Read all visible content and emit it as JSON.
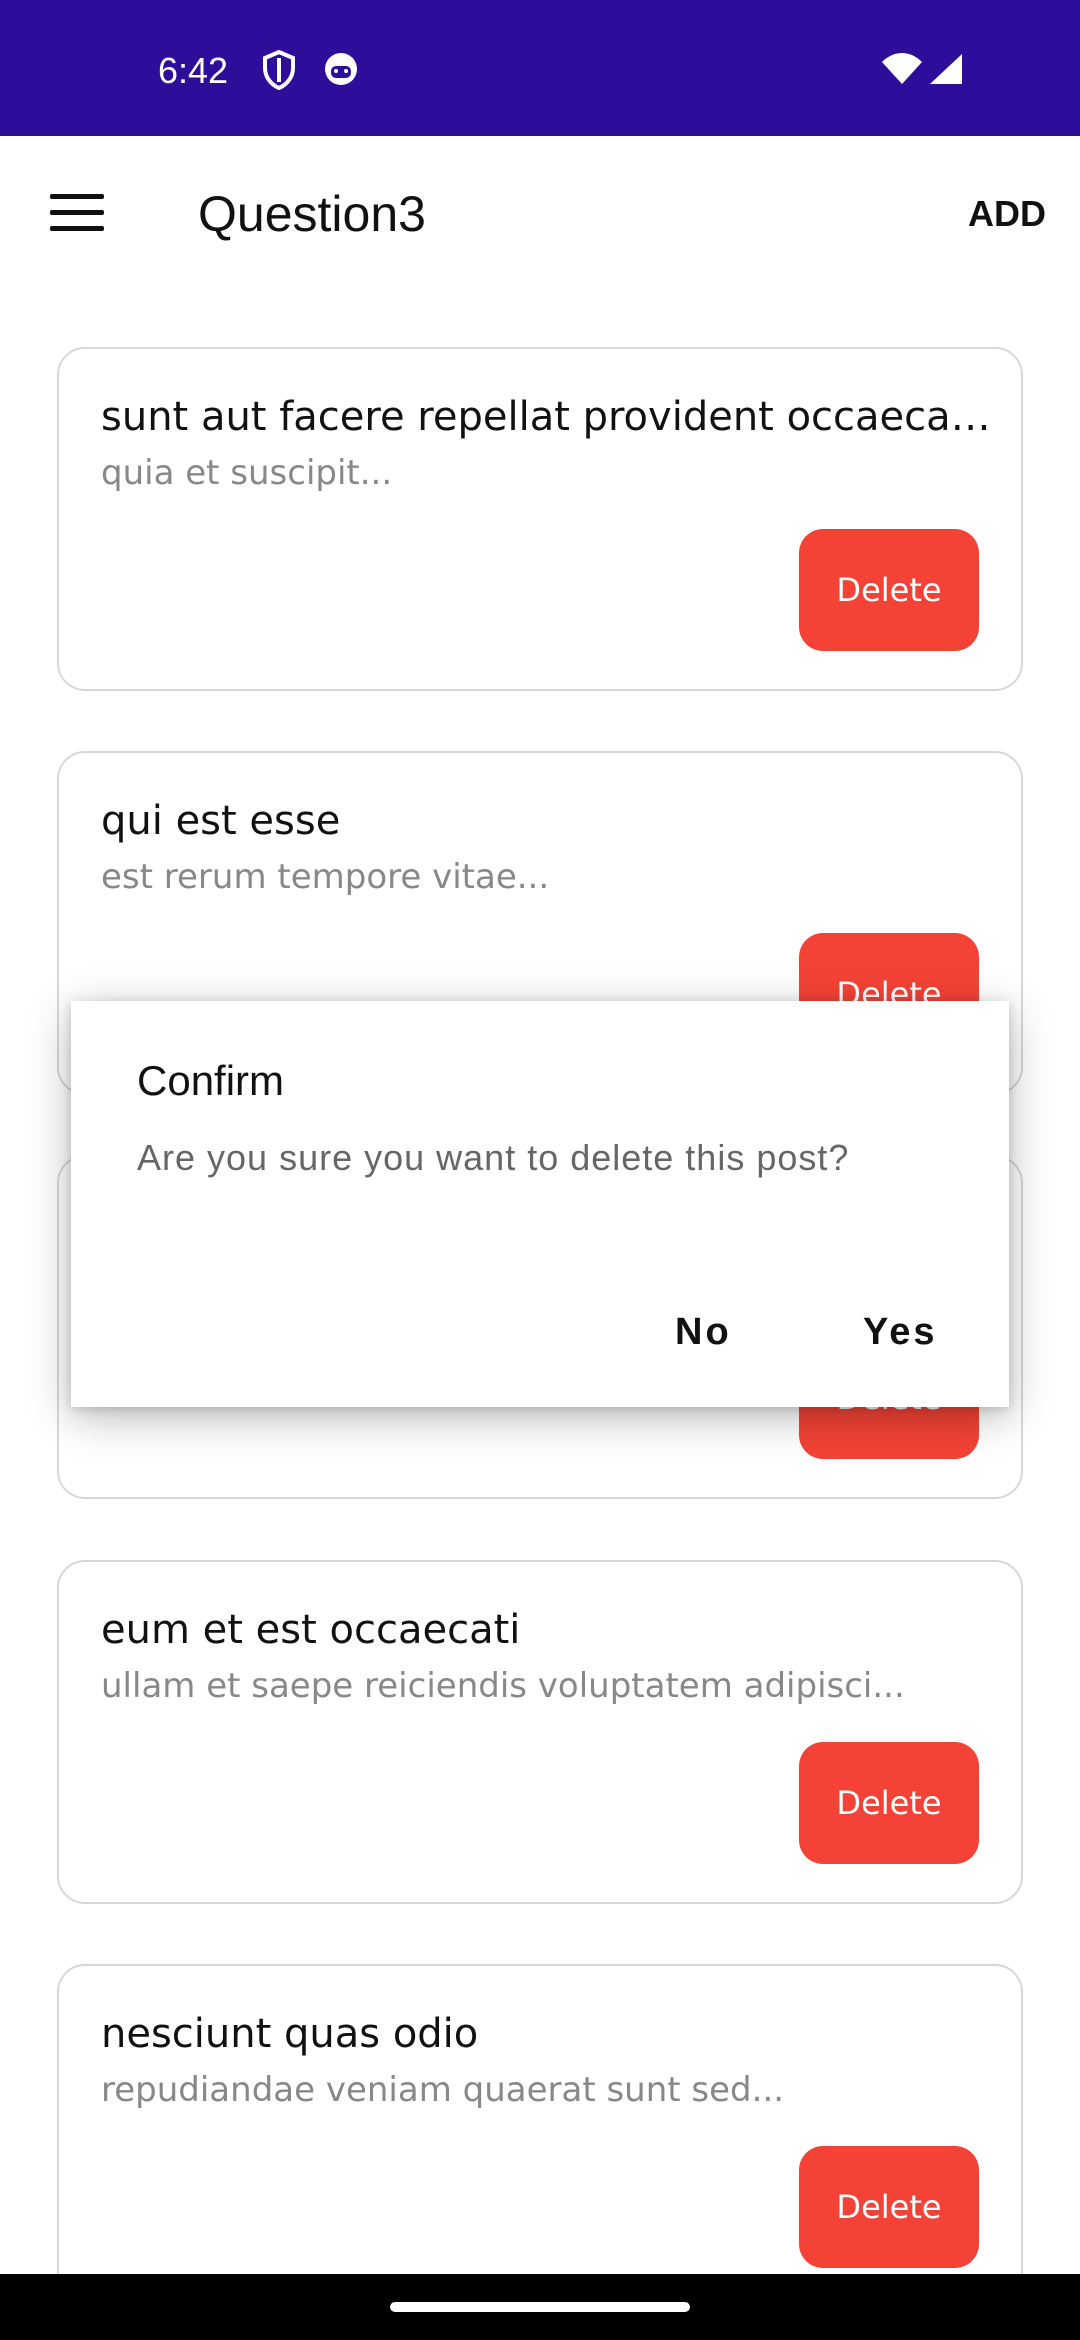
{
  "status_bar": {
    "time": "6:42",
    "icons": [
      "shield-icon",
      "face-icon",
      "wifi-icon",
      "signal-icon"
    ]
  },
  "app_bar": {
    "title": "Question3",
    "add_label": "ADD",
    "menu_icon": "menu-icon"
  },
  "posts": [
    {
      "title": "sunt aut facere repellat provident occaecati excepturi optio reprehenderit",
      "body": "quia et suscipit...",
      "delete_label": "Delete"
    },
    {
      "title": "qui est esse",
      "body": "est rerum tempore vitae...",
      "delete_label": "Delete"
    },
    {
      "title": "",
      "body": "",
      "delete_label": "Delete"
    },
    {
      "title": "eum et est occaecati",
      "body": "ullam et saepe reiciendis voluptatem adipisci...",
      "delete_label": "Delete"
    },
    {
      "title": "nesciunt quas odio",
      "body": "repudiandae veniam quaerat sunt sed...",
      "delete_label": "Delete"
    }
  ],
  "dialog": {
    "title": "Confirm",
    "message": "Are you sure you want to delete this post?",
    "no_label": "No",
    "yes_label": "Yes"
  },
  "colors": {
    "status_bar": "#2e0d9a",
    "delete_button": "#f44336"
  }
}
